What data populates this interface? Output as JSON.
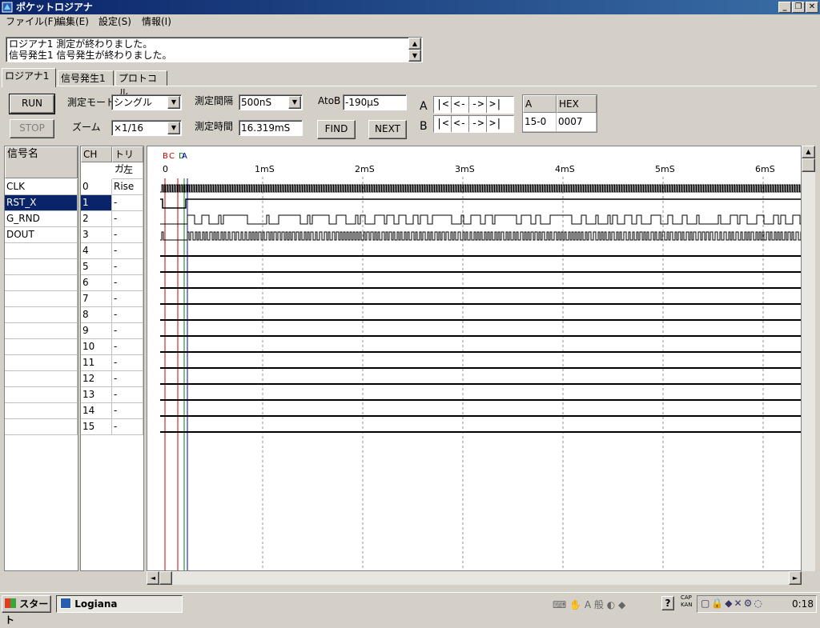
{
  "window": {
    "title": "ポケットロジアナ"
  },
  "menu": [
    "ファイル(F)",
    "編集(E)",
    "設定(S)",
    "情報(I)"
  ],
  "messages": [
    "ロジアナ1 測定が終わりました。",
    "信号発生1 信号発生が終わりました。"
  ],
  "tabs": [
    "ロジアナ1",
    "信号発生1",
    "プロトコル"
  ],
  "controls": {
    "run_label": "RUN",
    "stop_label": "STOP",
    "mode_label": "測定モード",
    "mode_value": "シングル",
    "zoom_label": "ズーム",
    "zoom_value": "×1/16",
    "interval_label": "測定間隔",
    "interval_value": "500nS",
    "duration_label": "測定時間",
    "duration_value": "16.319mS",
    "atob_label": "AtoB",
    "atob_value": "-190μS",
    "find_label": "FIND",
    "next_label": "NEXT",
    "cursor_a_label": "A",
    "cursor_b_label": "B",
    "nav_buttons": [
      "|<",
      "<-",
      "->",
      ">|"
    ]
  },
  "hex_table": {
    "headers": [
      "A",
      "HEX"
    ],
    "row": [
      "15-0",
      "0007"
    ]
  },
  "signal_table": {
    "name_header": "信号名",
    "ch_header": "CH",
    "trig_header": "トリガ",
    "trig_subheader": "左",
    "rows": [
      {
        "name": "CLK",
        "ch": "0",
        "trig": "Rise"
      },
      {
        "name": "RST_X",
        "ch": "1",
        "trig": "-"
      },
      {
        "name": "G_RND",
        "ch": "2",
        "trig": "-"
      },
      {
        "name": "DOUT",
        "ch": "3",
        "trig": "-"
      },
      {
        "name": "",
        "ch": "4",
        "trig": "-"
      },
      {
        "name": "",
        "ch": "5",
        "trig": "-"
      },
      {
        "name": "",
        "ch": "6",
        "trig": "-"
      },
      {
        "name": "",
        "ch": "7",
        "trig": "-"
      },
      {
        "name": "",
        "ch": "8",
        "trig": "-"
      },
      {
        "name": "",
        "ch": "9",
        "trig": "-"
      },
      {
        "name": "",
        "ch": "10",
        "trig": "-"
      },
      {
        "name": "",
        "ch": "11",
        "trig": "-"
      },
      {
        "name": "",
        "ch": "12",
        "trig": "-"
      },
      {
        "name": "",
        "ch": "13",
        "trig": "-"
      },
      {
        "name": "",
        "ch": "14",
        "trig": "-"
      },
      {
        "name": "",
        "ch": "15",
        "trig": "-"
      }
    ]
  },
  "waveform": {
    "time_labels": [
      "0",
      "1mS",
      "2mS",
      "3mS",
      "4mS",
      "5mS",
      "6mS"
    ],
    "cursor_labels": [
      "B",
      "C",
      "D",
      "A"
    ],
    "cursor_colors": [
      "#c00000",
      "#c00000",
      "#008000",
      "#0000c0"
    ]
  },
  "taskbar": {
    "start_label": "スタート",
    "task_label": "Logiana",
    "clock": "0:18",
    "tray_caps": "CAP",
    "tray_kana": "KAN"
  }
}
